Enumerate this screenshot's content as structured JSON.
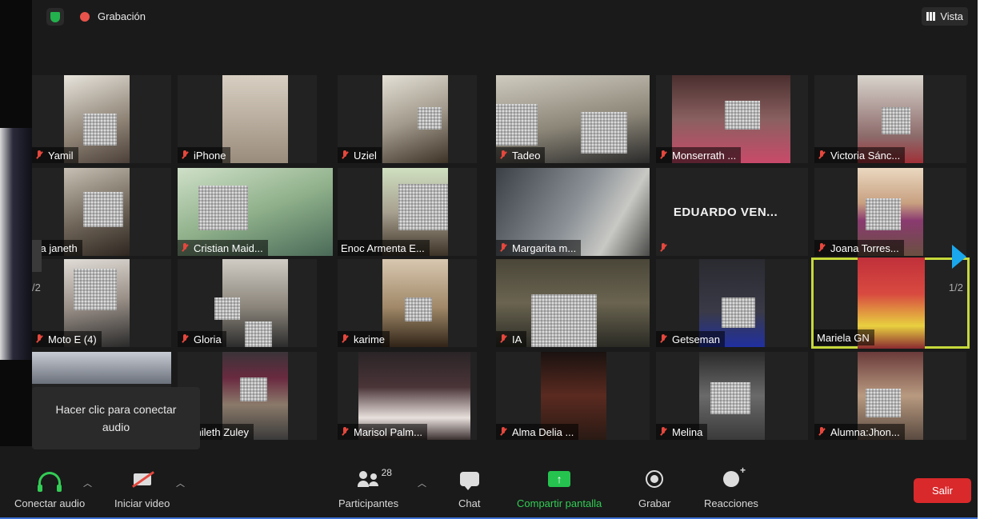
{
  "topbar": {
    "recording_label": "Grabación",
    "view_label": "Vista"
  },
  "participants": [
    {
      "name": "Yamil",
      "muted": true
    },
    {
      "name": "iPhone",
      "muted": true
    },
    {
      "name": "Uziel",
      "muted": true
    },
    {
      "name": "Tadeo",
      "muted": true
    },
    {
      "name": "Monserrath ...",
      "muted": true
    },
    {
      "name": "Victoria Sánc...",
      "muted": true
    },
    {
      "name": "sa janeth",
      "muted": false
    },
    {
      "name": "Cristian Maid...",
      "muted": true
    },
    {
      "name": "Enoc Armenta E...",
      "muted": false
    },
    {
      "name": "Margarita m...",
      "muted": true
    },
    {
      "name": "EDUARDO VEN...",
      "muted": true
    },
    {
      "name": "Joana Torres...",
      "muted": true
    },
    {
      "name": "Moto E (4)",
      "muted": true
    },
    {
      "name": "Gloria",
      "muted": true
    },
    {
      "name": "karime",
      "muted": true
    },
    {
      "name": "IA",
      "muted": true
    },
    {
      "name": "Getseman",
      "muted": true
    },
    {
      "name": "Mariela GN",
      "muted": false
    },
    {
      "name": "",
      "muted": false
    },
    {
      "name": "Yamileth Zuley",
      "muted": false
    },
    {
      "name": "Marisol Palm...",
      "muted": true
    },
    {
      "name": "Alma Delia ...",
      "muted": true
    },
    {
      "name": "Melina",
      "muted": true
    },
    {
      "name": "Alumna:Jhon...",
      "muted": true
    }
  ],
  "pagination": {
    "left_page": "/2",
    "right_page": "1/2"
  },
  "tooltip": {
    "text": "Hacer clic para conectar audio"
  },
  "toolbar": {
    "connect_audio": "Conectar audio",
    "start_video": "Iniciar video",
    "participants": "Participantes",
    "participants_count": "28",
    "chat": "Chat",
    "share_screen": "Compartir pantalla",
    "record": "Grabar",
    "reactions": "Reacciones",
    "leave": "Salir"
  }
}
